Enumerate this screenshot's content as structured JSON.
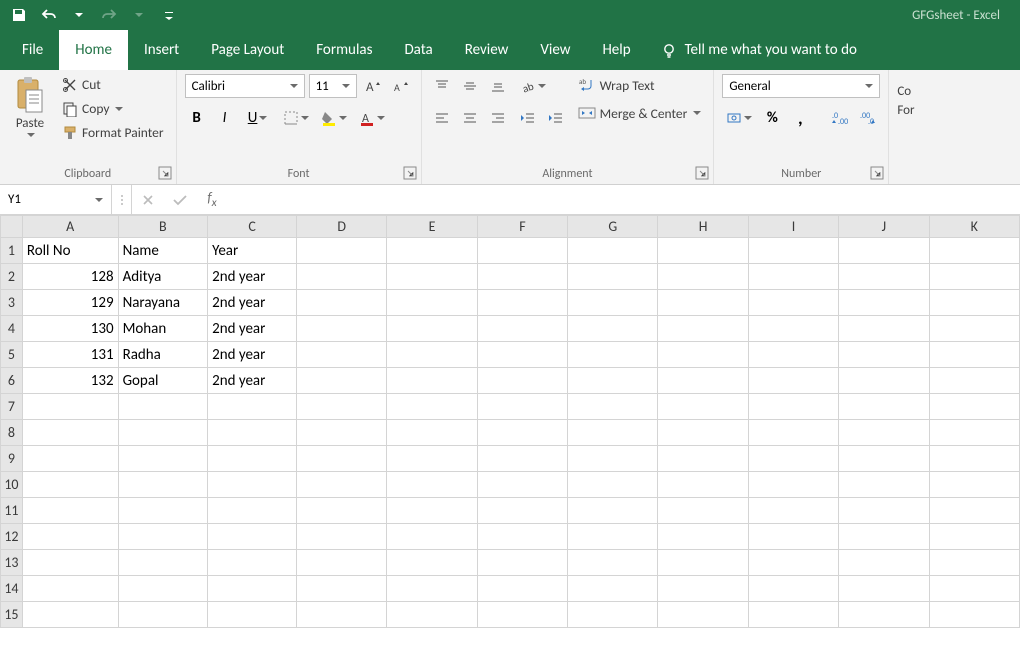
{
  "title": "GFGsheet  -  Excel",
  "menu": {
    "file": "File",
    "home": "Home",
    "insert": "Insert",
    "page_layout": "Page Layout",
    "formulas": "Formulas",
    "data": "Data",
    "review": "Review",
    "view": "View",
    "help": "Help",
    "tell_me": "Tell me what you want to do"
  },
  "ribbon": {
    "clipboard": {
      "paste": "Paste",
      "cut": "Cut",
      "copy": "Copy",
      "format_painter": "Format Painter",
      "label": "Clipboard"
    },
    "font": {
      "name": "Calibri",
      "size": "11",
      "label": "Font"
    },
    "alignment": {
      "wrap": "Wrap Text",
      "merge": "Merge & Center",
      "label": "Alignment"
    },
    "number": {
      "format": "General",
      "label": "Number"
    },
    "extra": {
      "conditional": "Co",
      "format": "For"
    }
  },
  "name_box": "Y1",
  "formula": "",
  "columns": [
    "A",
    "B",
    "C",
    "D",
    "E",
    "F",
    "G",
    "H",
    "I",
    "J",
    "K"
  ],
  "rows": [
    1,
    2,
    3,
    4,
    5,
    6,
    7,
    8,
    9,
    10,
    11,
    12,
    13,
    14,
    15
  ],
  "cells": {
    "A1": "Roll No",
    "B1": "Name",
    "C1": "Year",
    "A2": "128",
    "B2": "Aditya",
    "C2": "2nd year",
    "A3": "129",
    "B3": "Narayana",
    "C3": "2nd year",
    "A4": "130",
    "B4": "Mohan",
    "C4": "2nd year",
    "A5": "131",
    "B5": "Radha",
    "C5": "2nd year",
    "A6": "132",
    "B6": "Gopal",
    "C6": "2nd year"
  }
}
